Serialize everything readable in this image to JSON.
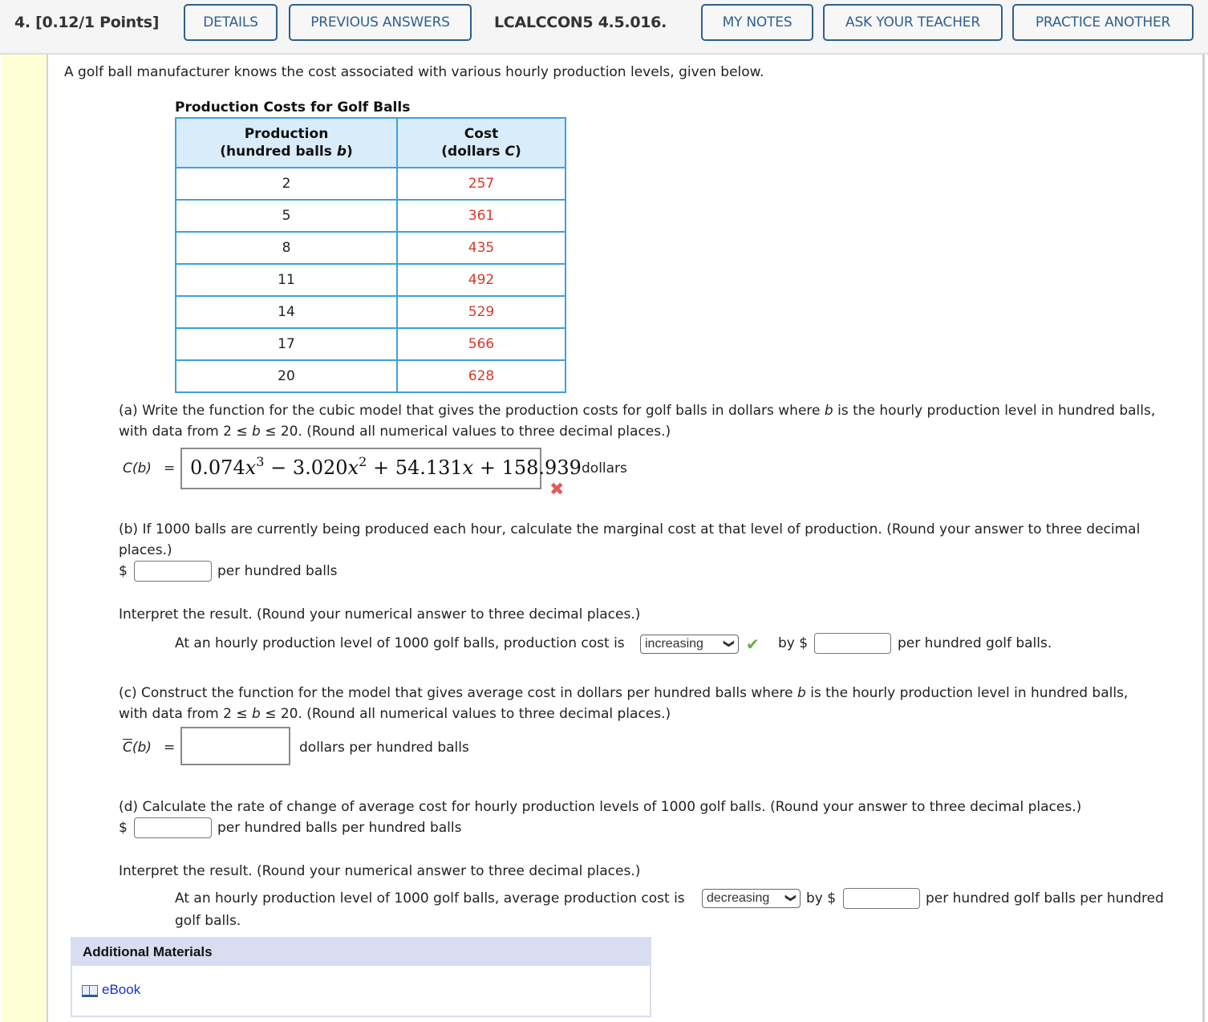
{
  "header": {
    "points": "4.  [0.12/1 Points]",
    "question_id": "LCALCCON5 4.5.016.",
    "buttons": {
      "details": "DETAILS",
      "previous_answers": "PREVIOUS ANSWERS",
      "my_notes": "MY NOTES",
      "ask_teacher": "ASK YOUR TEACHER",
      "practice_another": "PRACTICE ANOTHER"
    },
    "accent_color": "#2f5f8f"
  },
  "intro": "A golf ball manufacturer knows the cost associated with various hourly production levels, given below.",
  "table": {
    "title": "Production Costs for Golf Balls",
    "headers": [
      {
        "line1": "Production",
        "line2_prefix": "(hundred balls ",
        "var": "b",
        "line2_suffix": ")"
      },
      {
        "line1": "Cost",
        "line2_prefix": "(dollars ",
        "var": "C",
        "line2_suffix": ")"
      }
    ],
    "rows": [
      {
        "b": "2",
        "c": "257"
      },
      {
        "b": "5",
        "c": "361"
      },
      {
        "b": "8",
        "c": "435"
      },
      {
        "b": "11",
        "c": "492"
      },
      {
        "b": "14",
        "c": "529"
      },
      {
        "b": "17",
        "c": "566"
      },
      {
        "b": "20",
        "c": "628"
      }
    ],
    "cost_color": "#d43a2a"
  },
  "part_a": {
    "line1_pre": "(a) Write the function for the cubic model that gives the production costs for golf balls in dollars where ",
    "var": "b",
    "line1_post": " is the hourly production level in hundred balls,",
    "line2_pre": "with data from  2 ≤ ",
    "line2_post": " ≤ 20.  (Round all numerical values to three decimal places.)",
    "label": "C(b)",
    "equals": "=",
    "answer": {
      "c3": "0.074",
      "c2": "3.020",
      "c1": "54.131",
      "c0": "158.939",
      "minus": "−",
      "plus": "+",
      "x": "x",
      "exp3": "3",
      "exp2": "2"
    },
    "unit": "dollars",
    "status": "incorrect"
  },
  "part_b": {
    "line1": "(b) If 1000 balls are currently being produced each hour, calculate the marginal cost at that level of production. (Round your answer to three decimal",
    "line2": "places.)",
    "dollar": "$",
    "input_value": "",
    "unit": "per hundred balls",
    "interpret": "Interpret the result. (Round your numerical answer to three decimal places.)",
    "sentence_pre": "At an hourly production level of 1000 golf balls, production cost is",
    "select_value": "increasing",
    "select_status": "correct",
    "by": "by $",
    "amount_value": "",
    "sentence_post": "per hundred golf balls."
  },
  "part_c": {
    "line1_pre": "(c) Construct the function for the model that gives average cost in dollars per hundred balls where ",
    "var": "b",
    "line1_post": " is the hourly production level in hundred balls,",
    "line2_pre": "with data from  2 ≤ ",
    "line2_post": " ≤ 20.  (Round all numerical values to three decimal places.)",
    "label_c": "C",
    "label_rest": "(b)",
    "equals": "=",
    "input_value": "",
    "unit": "dollars per hundred balls"
  },
  "part_d": {
    "line1": "(d) Calculate the rate of change of average cost for hourly production levels of 1000 golf balls. (Round your answer to three decimal places.)",
    "dollar": "$",
    "input_value": "",
    "unit": "per hundred balls per hundred balls",
    "interpret": "Interpret the result. (Round your numerical answer to three decimal places.)",
    "sentence_pre": "At an hourly production level of 1000 golf balls, average production cost is",
    "select_value": "decreasing",
    "by": "by $",
    "amount_value": "",
    "sentence_post": "per hundred golf balls per hundred",
    "sentence_cont": "golf balls."
  },
  "additional": {
    "title": "Additional Materials",
    "ebook": "eBook"
  },
  "icons": {
    "chevron": "❯",
    "x": "✖",
    "check": "✔"
  }
}
